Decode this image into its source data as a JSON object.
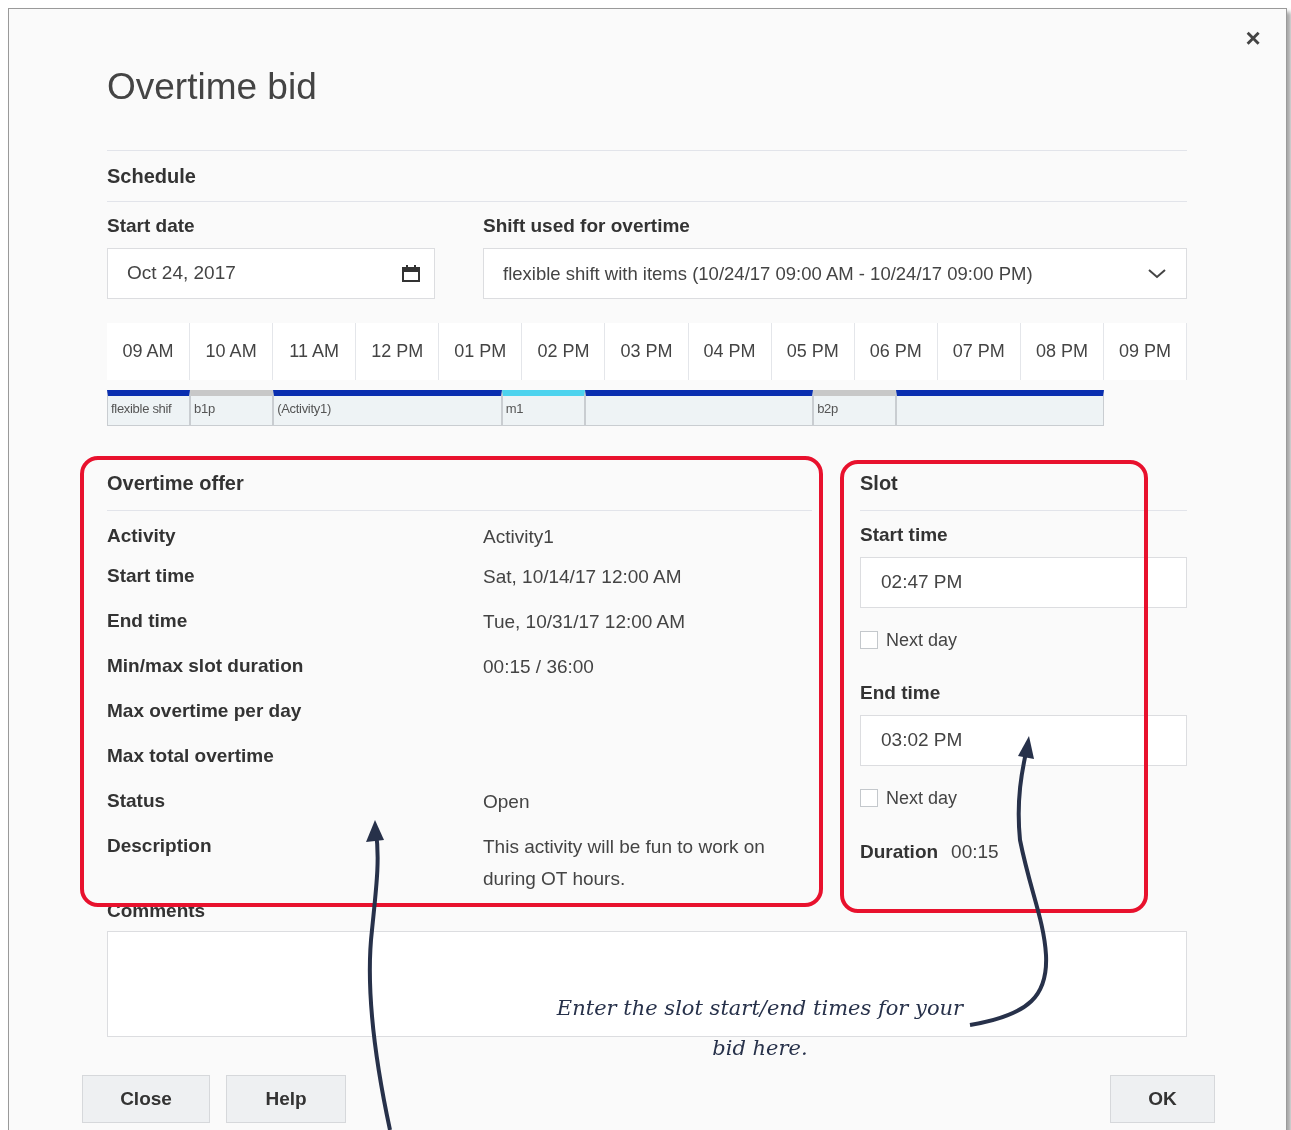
{
  "dialog": {
    "title": "Overtime bid",
    "close": "×"
  },
  "schedule": {
    "heading": "Schedule",
    "start_date": {
      "label": "Start date",
      "value": "Oct 24, 2017"
    },
    "shift": {
      "label": "Shift used for overtime",
      "value": "flexible shift with items (10/24/17 09:00 AM - 10/24/17 09:00 PM)"
    },
    "hours": [
      "09 AM",
      "10 AM",
      "11 AM",
      "12 PM",
      "01 PM",
      "02 PM",
      "03 PM",
      "04 PM",
      "05 PM",
      "06 PM",
      "07 PM",
      "08 PM",
      "09 PM"
    ],
    "segments": [
      {
        "label": "flexible shif",
        "color": "#0a2fb0"
      },
      {
        "label": "b1p",
        "color": "#c8c8c8"
      },
      {
        "label": "(Activity1)",
        "color": "#0a2fb0"
      },
      {
        "label": "m1",
        "color": "#4dd3ee"
      },
      {
        "color": "#0a2fb0"
      },
      {
        "label": "b2p",
        "color": "#c8c8c8"
      },
      {
        "color": "#0a2fb0"
      }
    ]
  },
  "overtime_offer": {
    "heading": "Overtime offer",
    "rows": [
      {
        "label": "Activity",
        "value": "Activity1"
      },
      {
        "label": "Start time",
        "value": "Sat, 10/14/17 12:00 AM"
      },
      {
        "label": "End time",
        "value": "Tue, 10/31/17 12:00 AM"
      },
      {
        "label": "Min/max slot duration",
        "value": "00:15 / 36:00"
      },
      {
        "label": "Max overtime per day"
      },
      {
        "label": "Max total overtime"
      },
      {
        "label": "Status",
        "value": "Open"
      },
      {
        "label": "Description",
        "value": "This activity will be fun to work on during OT hours."
      }
    ]
  },
  "slot": {
    "heading": "Slot",
    "start_time": {
      "label": "Start time",
      "value": "02:47 PM",
      "next_day": {
        "label": "Next day",
        "checked": false
      }
    },
    "end_time": {
      "label": "End time",
      "value": "03:02 PM",
      "next_day": {
        "label": "Next day",
        "checked": false
      }
    },
    "duration": {
      "label": "Duration",
      "value": "00:15"
    }
  },
  "comments": {
    "label": "Comments"
  },
  "buttons": {
    "left": [
      "Close",
      "Help"
    ],
    "right": [
      "OK"
    ]
  },
  "annotation": {
    "text": "Enter the slot start/end times for your bid here."
  }
}
